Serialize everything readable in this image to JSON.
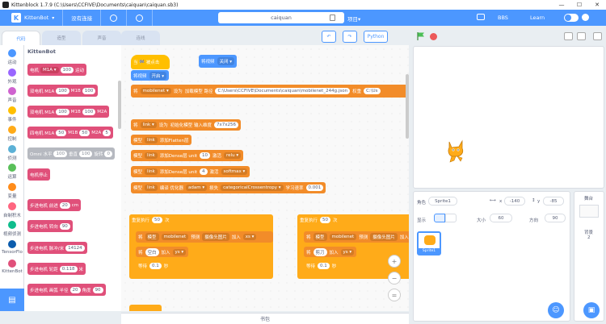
{
  "window": {
    "title": "Kittenblock 1.7.9 (C:\\Users\\CCFIVE\\Documents\\caiquan\\caiquan.sb3)",
    "min": "—",
    "max": "☐",
    "close": "✕"
  },
  "menubar": {
    "brand": "KittenBot",
    "connect": "没有连接",
    "project_name": "caiquan",
    "project_menu": "项目▾",
    "bbs": "BBS",
    "learn": "Learn"
  },
  "tabs": {
    "code": "代码",
    "costumes": "造型",
    "sounds": "声音",
    "tour": "连线"
  },
  "categories": [
    {
      "label": "运动",
      "color": "#4c97ff"
    },
    {
      "label": "外观",
      "color": "#9966ff"
    },
    {
      "label": "声音",
      "color": "#cf63cf"
    },
    {
      "label": "事件",
      "color": "#ffbf00"
    },
    {
      "label": "控制",
      "color": "#ffab19"
    },
    {
      "label": "侦测",
      "color": "#5cb1d6"
    },
    {
      "label": "运算",
      "color": "#59c059"
    },
    {
      "label": "变量",
      "color": "#ff8c1a"
    },
    {
      "label": "自制积木",
      "color": "#ff6680"
    },
    {
      "label": "视频侦测",
      "color": "#0fbd8c"
    },
    {
      "label": "TensorFlo",
      "color": "#0b5cad"
    },
    {
      "label": "KittenBot",
      "color": "#e0507a"
    }
  ],
  "palette": {
    "heading": "KittenBot",
    "blocks": [
      {
        "pre": "电机",
        "dd": "M1A ▾",
        "mid": "运动",
        "v1": "100"
      },
      {
        "pre": "双电机 M1A",
        "v1": "100",
        "mid": "M1B",
        "v2": "100"
      },
      {
        "pre": "双电机 M1A",
        "v1": "100",
        "mid": "M1B",
        "v2": "100",
        "post": "M2A"
      },
      {
        "pre": "四电机 M1A",
        "v1": "50",
        "mid": "M1B",
        "v2": "50",
        "post": "M2A",
        "v3": "5"
      },
      {
        "pre": "Omni 水平",
        "v1": "100",
        "mid": "垂直",
        "v2": "100",
        "post": "旋转",
        "v3": "0"
      },
      {
        "pre": "电机停止"
      },
      {
        "pre": "步进电机 前进",
        "v1": "20",
        "mid": "cm"
      },
      {
        "pre": "步进电机 转向",
        "v1": "90"
      },
      {
        "pre": "步进电机 脉冲/米",
        "v1": "14124"
      },
      {
        "pre": "步进电机 轮距",
        "v1": "0.118",
        "mid": "米"
      },
      {
        "pre": "步进电机 画弧 半径",
        "v1": "20",
        "mid": "角度",
        "v2": "90"
      }
    ]
  },
  "toolbar": {
    "undo": "↶",
    "redo": "↷",
    "python": "Python",
    "cn": "积木",
    "en": "C/Ot"
  },
  "workspace": {
    "hat": "当 🏁 被点击",
    "video_off": {
      "label": "将视频",
      "dd": "关闭 ▾"
    },
    "video_on": {
      "label": "将视频",
      "dd": "开启 ▾"
    },
    "load_model": {
      "a": "将",
      "var": "mobilenet ▾",
      "b": "设为",
      "c": "加载模型 路径",
      "path": "C:\\Users\\CCFIVE\\Documents\\caiquan\\mobilenet_244g.json",
      "d": "权重",
      "e": "C:\\Us"
    },
    "link_init": {
      "a": "将",
      "var": "link ▾",
      "b": "设为",
      "c": "初始化模型 输入维度",
      "v": "7x7x256"
    },
    "flatten": {
      "a": "模型",
      "var": "link",
      "b": "添加Flatten层"
    },
    "dense1": {
      "a": "模型",
      "var": "link",
      "b": "添加Dense层 unit",
      "v": "10",
      "c": "激活",
      "dd": "relu ▾"
    },
    "dense2": {
      "a": "模型",
      "var": "link",
      "b": "添加Dense层 unit",
      "v": "4",
      "c": "激活",
      "dd": "softmax ▾"
    },
    "compile": {
      "a": "模型",
      "var": "link",
      "b": "编译 优化器",
      "dd": "adam ▾",
      "c": "损失",
      "dd2": "categoricalCrossentropy ▾",
      "d": "学习速率",
      "v": "0.001"
    },
    "repeat1": {
      "a": "重复执行",
      "v": "50",
      "b": "次"
    },
    "add1": {
      "a": "将",
      "b": "模型",
      "var": "mobilenet",
      "c": "预测",
      "d": "摄像头图片",
      "e": "加入",
      "dd": "xs ▾"
    },
    "add1b": {
      "a": "将",
      "w": "空白",
      "b": "加入",
      "dd": "ys ▾"
    },
    "wait1": {
      "a": "等待",
      "v": "0.1",
      "b": "秒"
    },
    "repeat2": {
      "a": "重复执行",
      "v": "50",
      "b": "次"
    },
    "add2": {
      "a": "将",
      "b": "模型",
      "var": "mobilenet",
      "c": "预测",
      "d": "摄像头图片",
      "e": "加入"
    },
    "add2b": {
      "a": "将",
      "w": "剪刀",
      "b": "加入",
      "dd": "ys ▾"
    },
    "wait2": {
      "a": "等待",
      "v": "0.1",
      "b": "秒"
    },
    "zoom_in": "+",
    "zoom_out": "−",
    "zoom_reset": "="
  },
  "backpack": "书包",
  "sprite": {
    "name_label": "角色",
    "name": "Sprite1",
    "x_label": "x",
    "x": "-140",
    "y_label": "y",
    "y": "-85",
    "show_label": "显示",
    "size_label": "大小",
    "size": "60",
    "dir_label": "方向",
    "dir": "90",
    "thumb_label": "Sprite1"
  },
  "stage_panel": {
    "title": "舞台",
    "backdrops_label": "背景",
    "count": "2"
  }
}
